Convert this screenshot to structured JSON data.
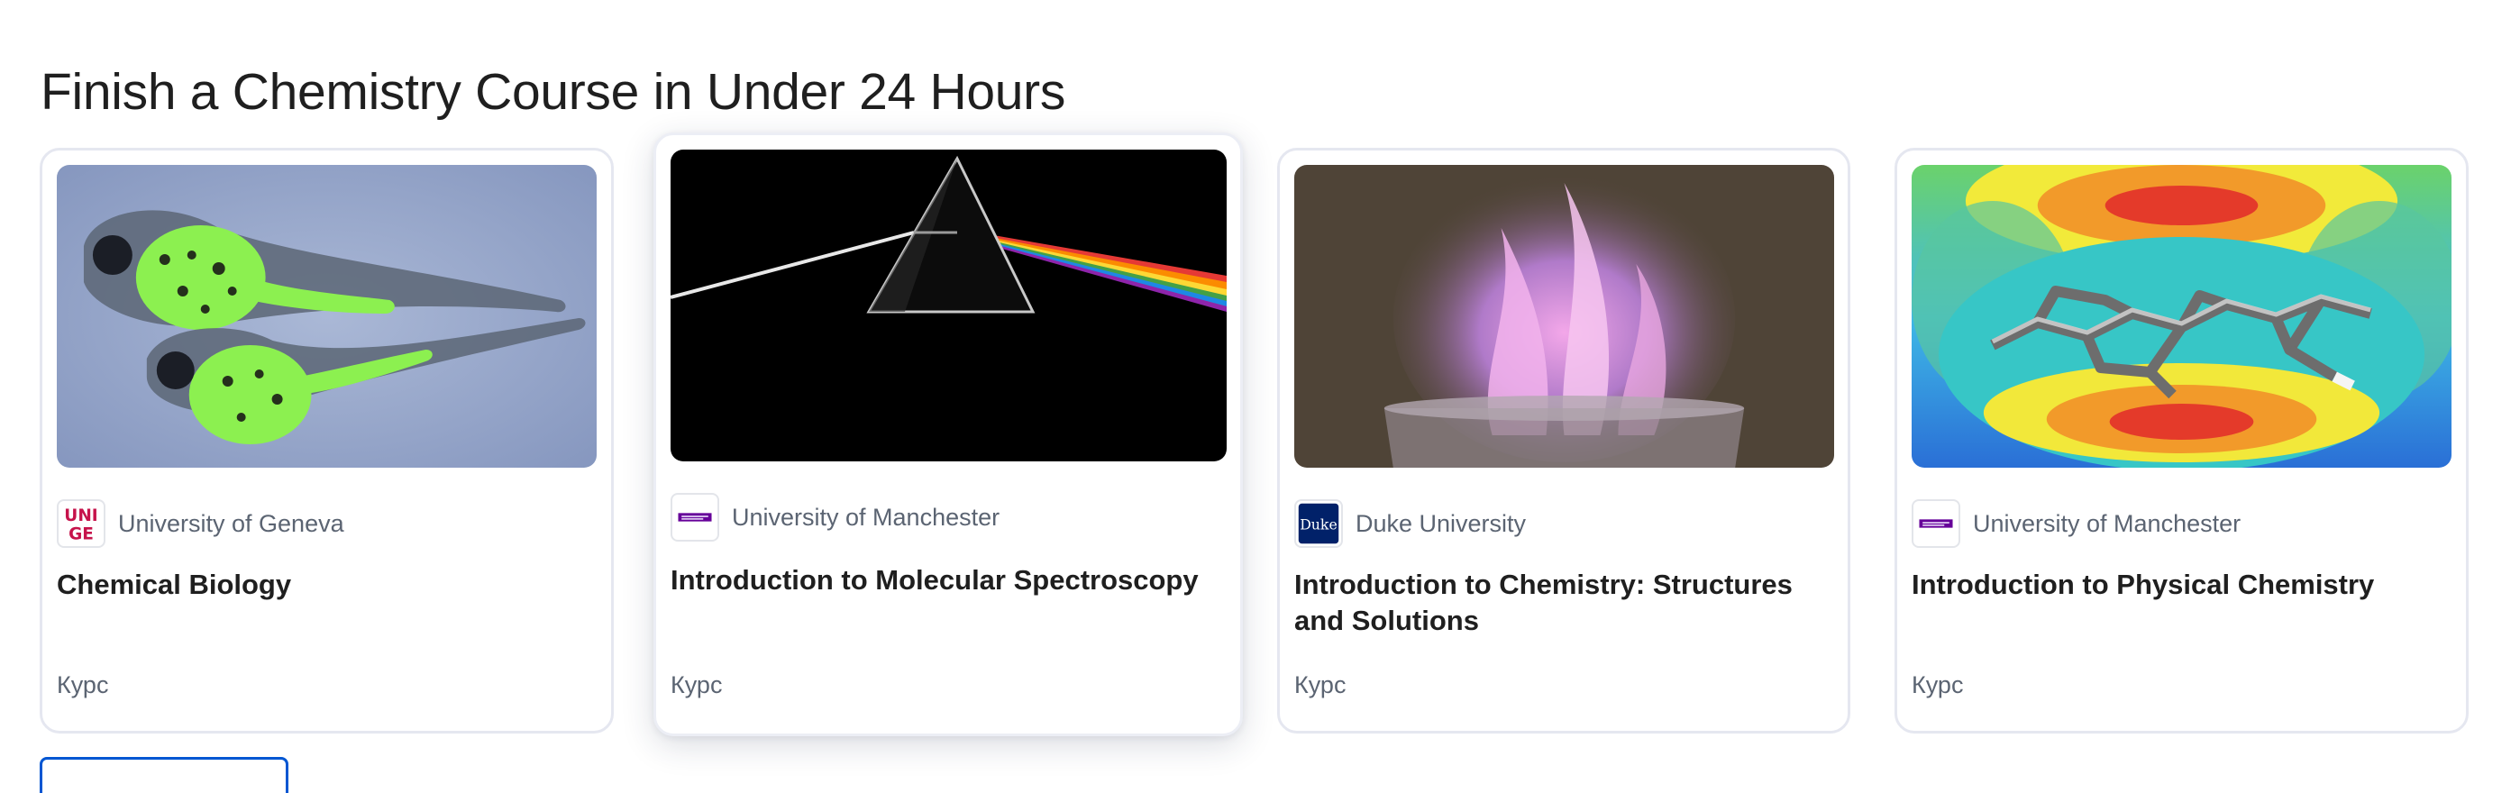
{
  "section": {
    "title": "Finish a Chemistry Course in Under 24 Hours"
  },
  "cards": [
    {
      "partner": "University of Geneva",
      "title": "Chemical Biology",
      "type": "Курс"
    },
    {
      "partner": "University of Manchester",
      "title": "Introduction to Molecular Spectroscopy",
      "type": "Курс"
    },
    {
      "partner": "Duke University",
      "title": "Introduction to Chemistry: Structures and Solutions",
      "type": "Курс"
    },
    {
      "partner": "University of Manchester",
      "title": "Introduction to Physical Chemistry",
      "type": "Курс"
    }
  ],
  "logos": {
    "geneva_text_top": "UNI",
    "geneva_text_bottom": "GE",
    "duke_text": "Duke"
  },
  "colors": {
    "accent": "#0056d2",
    "card_border": "#e5e7f0",
    "muted_text": "#5b6472",
    "geneva_logo": "#c6134b",
    "manchester_logo": "#660099",
    "duke_logo": "#012169"
  },
  "show_more": {
    "label": ""
  }
}
